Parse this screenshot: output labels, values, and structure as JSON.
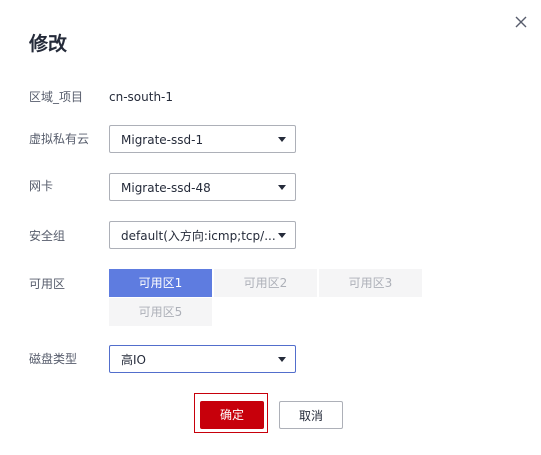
{
  "dialog": {
    "title": "修改",
    "close_icon": "close-icon"
  },
  "form": {
    "region_label": "区域_项目",
    "region_value": "cn-south-1",
    "vpc_label": "虚拟私有云",
    "vpc_value": "Migrate-ssd-1",
    "nic_label": "网卡",
    "nic_value": "Migrate-ssd-48",
    "sg_label": "安全组",
    "sg_value": "default(入方向:icmp;tcp/...",
    "az_label": "可用区",
    "az_options": [
      "可用区1",
      "可用区2",
      "可用区3",
      "可用区5"
    ],
    "az_selected": "可用区1",
    "disk_label": "磁盘类型",
    "disk_value": "高IO"
  },
  "buttons": {
    "confirm": "确定",
    "cancel": "取消"
  },
  "colors": {
    "primary": "#c7000b",
    "az_selected": "#5e7ce0",
    "focus_border": "#526ecc"
  }
}
